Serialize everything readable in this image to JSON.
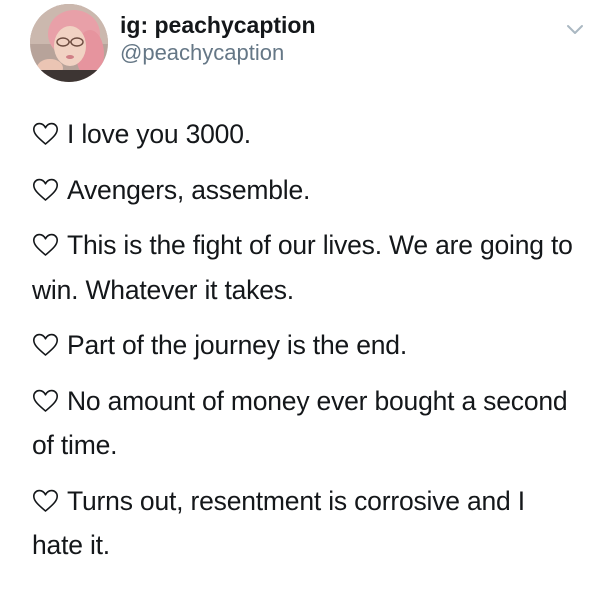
{
  "profile": {
    "display_name": "ig: peachycaption",
    "handle": "@peachycaption",
    "avatar_icon": "profile-photo-avatar",
    "menu_icon": "chevron-down-icon"
  },
  "tweet": {
    "items": [
      {
        "icon": "heart-outline-icon",
        "text": "I love you 3000."
      },
      {
        "icon": "heart-outline-icon",
        "text": "Avengers, assemble."
      },
      {
        "icon": "heart-outline-icon",
        "text": "This is the fight of our lives. We are going to win. Whatever it takes."
      },
      {
        "icon": "heart-outline-icon",
        "text": "Part of the journey is the end."
      },
      {
        "icon": "heart-outline-icon",
        "text": "No amount of money ever bought a second of time."
      },
      {
        "icon": "heart-outline-icon",
        "text": "Turns out, resentment is corrosive and I hate it."
      }
    ]
  },
  "colors": {
    "text": "#14171a",
    "secondary_text": "#657786",
    "background": "#ffffff"
  }
}
